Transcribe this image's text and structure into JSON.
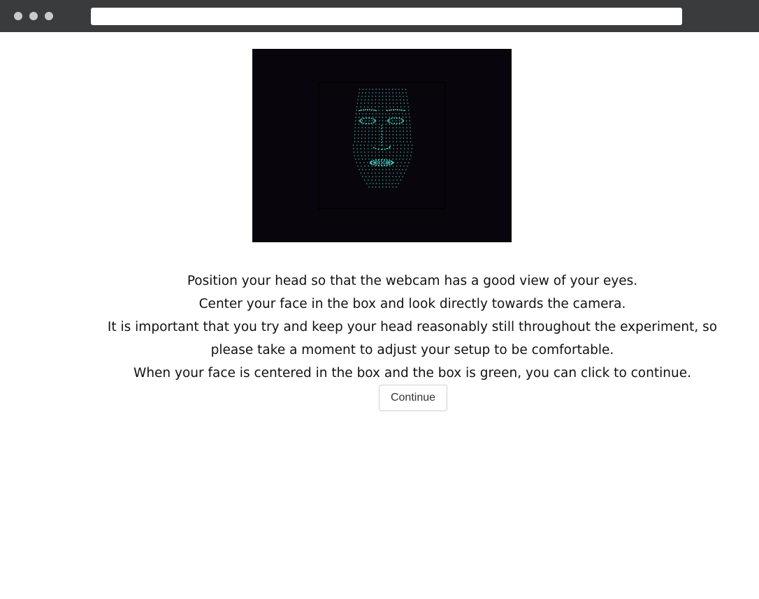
{
  "browser": {
    "url": ""
  },
  "webcam": {
    "description_icon": "face-mesh-icon",
    "box_color": "#000000",
    "mesh_color": "#3fc8b8"
  },
  "instructions": {
    "line1": "Position your head so that the webcam has a good view of your eyes.",
    "line2": "Center your face in the box and look directly towards the camera.",
    "line3": "It is important that you try and keep your head reasonably still throughout the experiment, so",
    "line4": "please take a moment to adjust your setup to be comfortable.",
    "line5": "When your face is centered in the box and the box is green, you can click to continue."
  },
  "buttons": {
    "continue_label": "Continue"
  }
}
